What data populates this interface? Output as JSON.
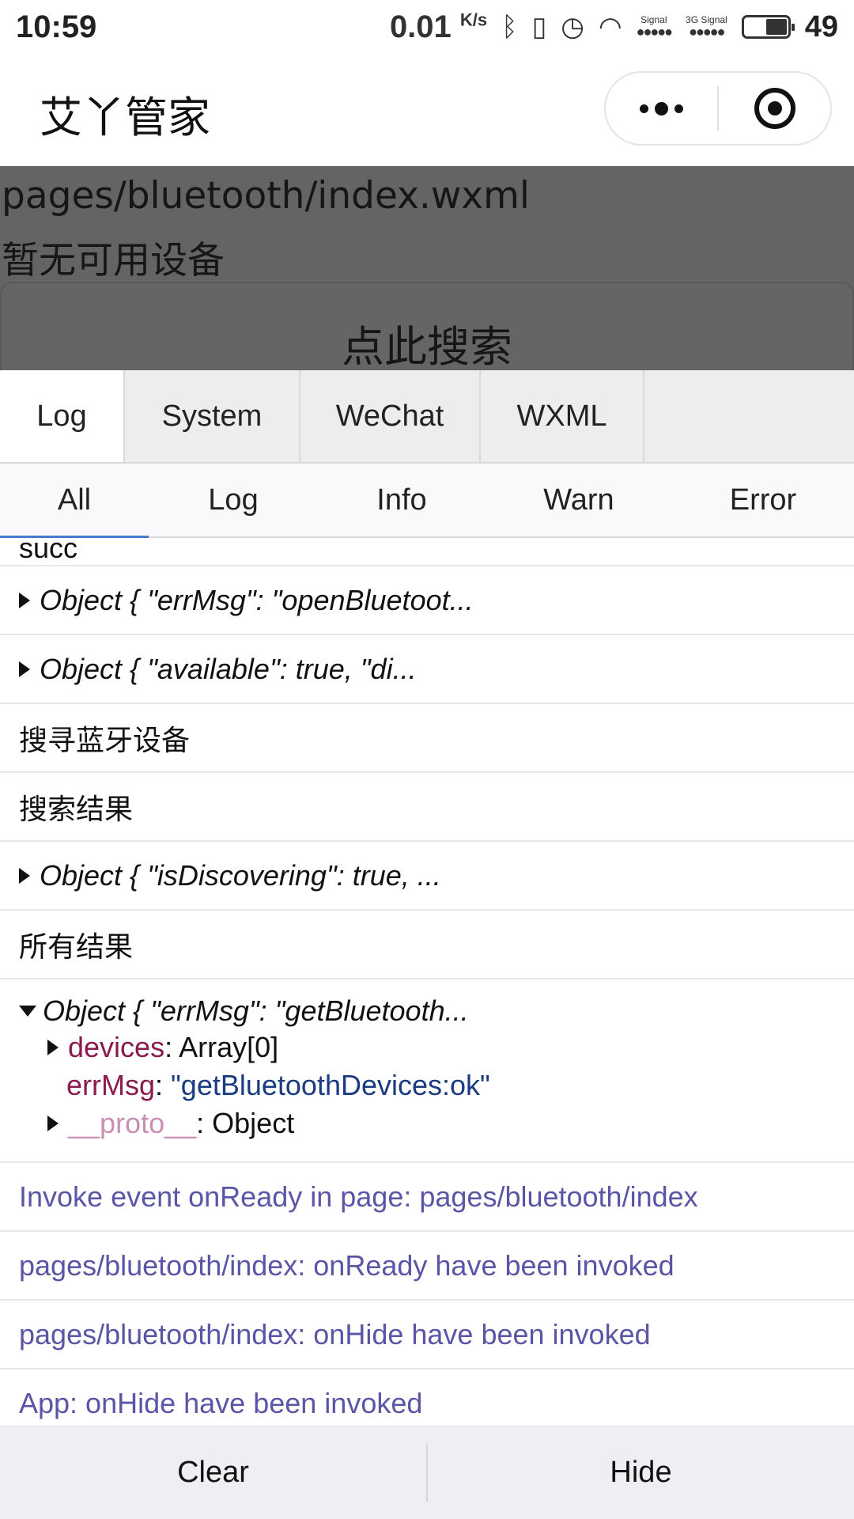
{
  "status_bar": {
    "time": "10:59",
    "net_speed": "0.01",
    "net_unit": "K/s",
    "signal_label_1": "Signal",
    "signal_label_2": "3G Signal",
    "battery_level": "49",
    "battery_fraction": 0.49
  },
  "navbar": {
    "title": "艾丫管家",
    "more_icon": "more-icon",
    "close_icon": "target-icon"
  },
  "page": {
    "path": "pages/bluetooth/index.wxml",
    "empty_text": "暂无可用设备",
    "search_button": "点此搜索"
  },
  "console": {
    "tabs": [
      {
        "label": "Log",
        "active": true
      },
      {
        "label": "System",
        "active": false
      },
      {
        "label": "WeChat",
        "active": false
      },
      {
        "label": "WXML",
        "active": false
      }
    ],
    "subtabs": [
      {
        "label": "All",
        "active": true
      },
      {
        "label": "Log",
        "active": false
      },
      {
        "label": "Info",
        "active": false
      },
      {
        "label": "Warn",
        "active": false
      },
      {
        "label": "Error",
        "active": false
      }
    ],
    "logs": {
      "r0": "succ",
      "r1": "Object { \"errMsg\": \"openBluetoot...",
      "r2": "Object { \"available\": true, \"di...",
      "r3": "搜寻蓝牙设备",
      "r4": "搜索结果",
      "r5": "Object { \"isDiscovering\": true, ...",
      "r6": "所有结果",
      "r7_head": "Object { \"errMsg\": \"getBluetooth...",
      "r7_devices_key": "devices",
      "r7_devices_val": ": Array[0]",
      "r7_errmsg_key": "errMsg",
      "r7_errmsg_sep": ": ",
      "r7_errmsg_val": "\"getBluetoothDevices:ok\"",
      "r7_proto_key": "__proto__",
      "r7_proto_val": ": Object",
      "r8": "Invoke event onReady in page: pages/bluetooth/index",
      "r9": "pages/bluetooth/index: onReady have been invoked",
      "r10": "pages/bluetooth/index: onHide have been invoked",
      "r11": "App: onHide have been invoked"
    }
  },
  "toolbar": {
    "clear": "Clear",
    "hide": "Hide"
  },
  "colors": {
    "system_log": "#5b55a8",
    "key": "#8a1a4e",
    "string": "#1a3a82",
    "active_underline": "#4a78d0"
  }
}
